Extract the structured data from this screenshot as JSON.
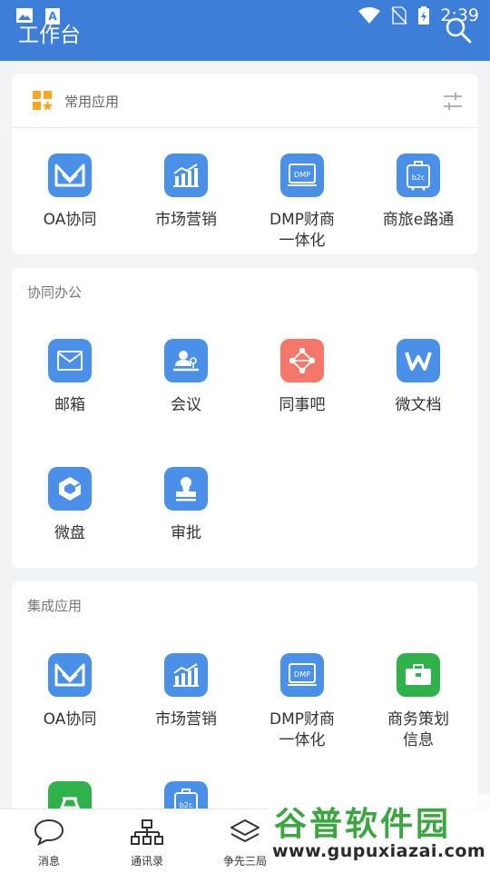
{
  "status_bar": {
    "time": "2:39"
  },
  "header": {
    "title": "工作台"
  },
  "favorites": {
    "title": "常用应用",
    "apps": [
      {
        "label": "OA协同",
        "icon": "oa-icon"
      },
      {
        "label": "市场营销",
        "icon": "marketing-chart-icon"
      },
      {
        "label": "DMP财商\n一体化",
        "icon": "dmp-icon"
      },
      {
        "label": "商旅e路通",
        "icon": "b2c-luggage-icon"
      }
    ]
  },
  "collab": {
    "title": "协同办公",
    "apps": [
      {
        "label": "邮箱",
        "icon": "mail-icon"
      },
      {
        "label": "会议",
        "icon": "meeting-icon"
      },
      {
        "label": "同事吧",
        "icon": "colleague-network-icon"
      },
      {
        "label": "微文档",
        "icon": "word-doc-icon"
      },
      {
        "label": "微盘",
        "icon": "cloud-disk-icon"
      },
      {
        "label": "审批",
        "icon": "approval-stamp-icon"
      }
    ]
  },
  "integrated": {
    "title": "集成应用",
    "apps": [
      {
        "label": "OA协同",
        "icon": "oa-icon"
      },
      {
        "label": "市场营销",
        "icon": "marketing-chart-icon"
      },
      {
        "label": "DMP财商\n一体化",
        "icon": "dmp-icon"
      },
      {
        "label": "商务策划\n信息",
        "icon": "briefcase-icon"
      }
    ]
  },
  "bottom_nav": [
    {
      "label": "消息",
      "icon": "chat-bubble-icon"
    },
    {
      "label": "通讯录",
      "icon": "org-chart-icon"
    },
    {
      "label": "争先三局",
      "icon": "layers-icon"
    }
  ],
  "watermark": {
    "title": "谷普软件园",
    "url": "www.gupuxiazai.com"
  },
  "colors": {
    "header": "#3d7fd8",
    "icon_blue": "#4a90e8",
    "icon_red": "#f4776a",
    "icon_green": "#2fb24c",
    "fav_orange": "#f5a623"
  }
}
